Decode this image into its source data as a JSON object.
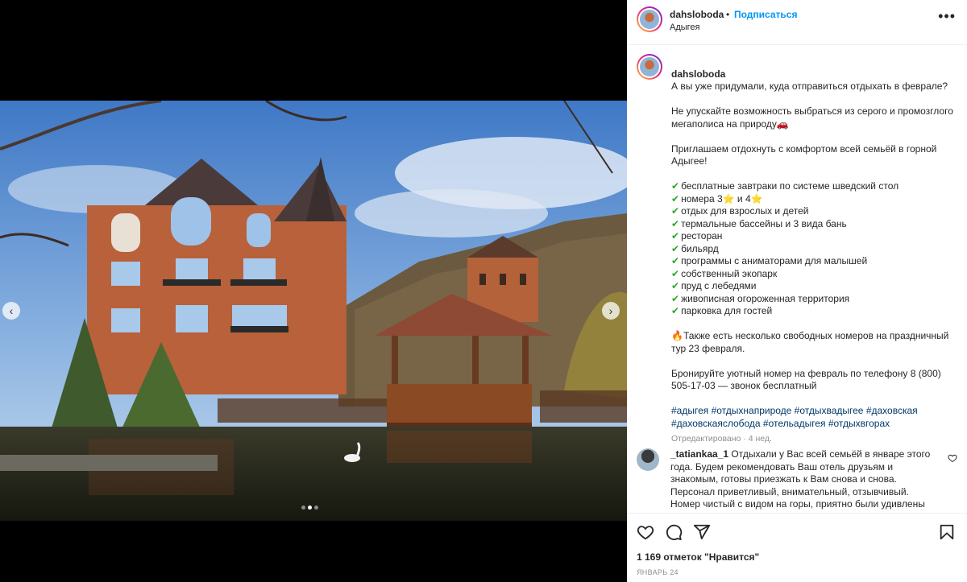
{
  "post": {
    "username": "dahsloboda",
    "separator": "•",
    "follow_label": "Подписаться",
    "location": "Адыгея",
    "more_label": "•••",
    "slides_count": 3,
    "active_slide": 2
  },
  "caption": {
    "username": "dahsloboda",
    "first": "А вы уже придумали, куда отправиться отдыхать в феврале?",
    "p2": "Не упускайте возможность выбраться из серого и промозглого мегаполиса на природу🚗",
    "p3": "Приглашаем отдохнуть с комфортом всей семьёй в горной Адыгее!",
    "checks": [
      "бесплатные завтраки по системе шведский стол",
      "номера 3⭐ и 4⭐",
      "отдых для взрослых и детей",
      "термальные бассейны и 3 вида бань",
      "ресторан",
      "бильярд",
      "программы с аниматорами для малышей",
      "собственный экопарк",
      "пруд с лебедями",
      "живописная огороженная территория",
      "парковка для гостей"
    ],
    "check_mark": "✔",
    "p4": "🔥Также есть несколько свободных номеров на праздничный тур 23 февраля.",
    "p5": "Бронируйте уютный номер на февраль по телефону 8 (800) 505-17-03 — звонок бесплатный",
    "tags": "#адыгея #отдыхнаприроде #отдыхвадыгее #даховская #даховскаяслобода #отельадыгея #отдыхвгорах",
    "edited": "Отредактировано · 4 нед."
  },
  "comment": {
    "username": "_tatiankaa_1",
    "text": "Отдыхали у Вас всей семьёй в январе этого года. Будем рекомендовать Ваш отель друзьям и знакомым, готовы приезжать к Вам снова и снова. Персонал приветливый, внимательный, отзывчивый. Номер чистый с видом на горы, приятно были удивлены ежедневной"
  },
  "stats": {
    "likes": "1 169 отметок \"Нравится\"",
    "date": "ЯНВАРЬ 24"
  },
  "icons": {
    "prev": "chevron-left-icon",
    "next": "chevron-right-icon",
    "like": "heart-icon",
    "comment": "comment-icon",
    "share": "share-icon",
    "save": "bookmark-icon"
  }
}
